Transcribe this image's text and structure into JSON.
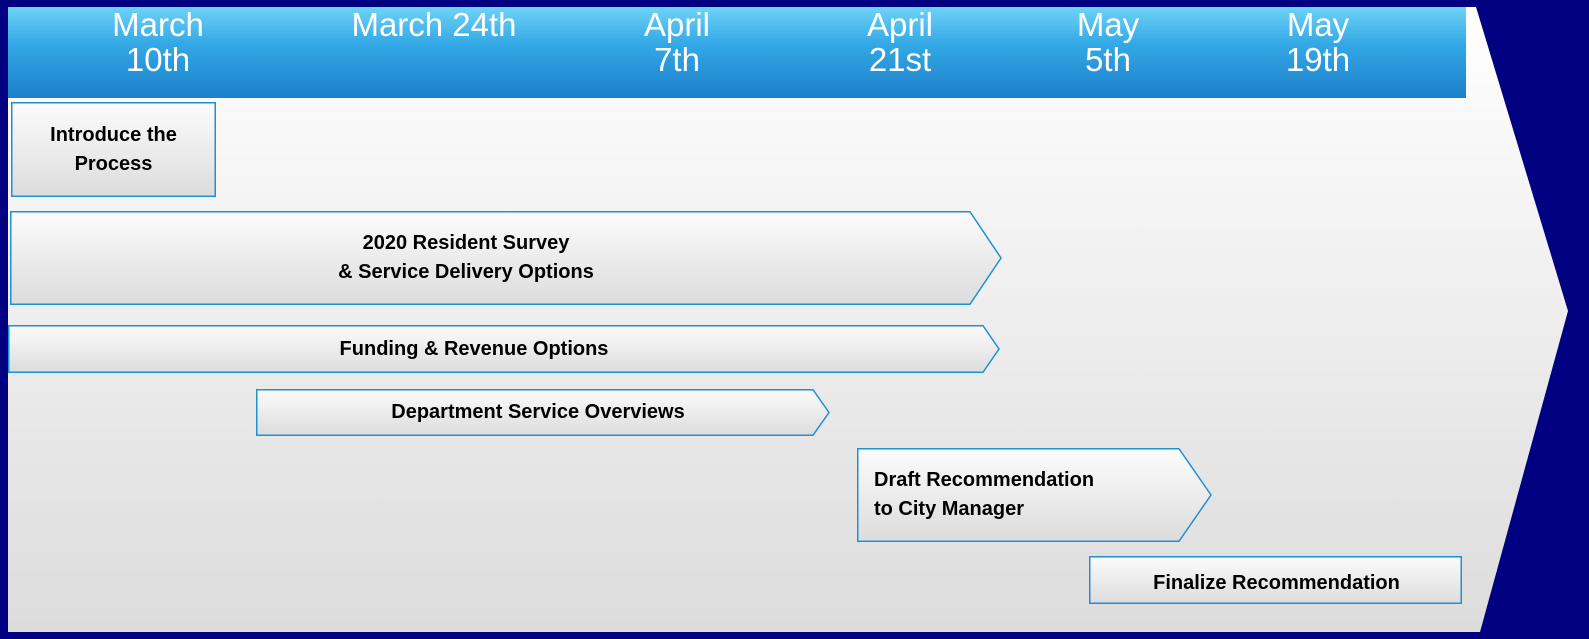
{
  "timeline": {
    "dates": [
      {
        "label": "March\n10th"
      },
      {
        "label": "March 24th"
      },
      {
        "label": "April\n7th"
      },
      {
        "label": "April\n21st"
      },
      {
        "label": "May\n5th"
      },
      {
        "label": "May\n19th"
      }
    ]
  },
  "tasks": [
    {
      "label": "Introduce the\nProcess"
    },
    {
      "label": "2020 Resident Survey\n& Service Delivery Options"
    },
    {
      "label": "Funding & Revenue Options"
    },
    {
      "label": "Department Service Overviews"
    },
    {
      "label": "Draft Recommendation\nto City Manager"
    },
    {
      "label": "Finalize Recommendation"
    }
  ],
  "colors": {
    "background": "#000080",
    "header_top": "#6ed3f6",
    "header_bottom": "#1c7fcb",
    "task_border": "#1f8fd6",
    "arrow_fill_light": "#f7f7f7",
    "arrow_fill_dark": "#dedede"
  }
}
